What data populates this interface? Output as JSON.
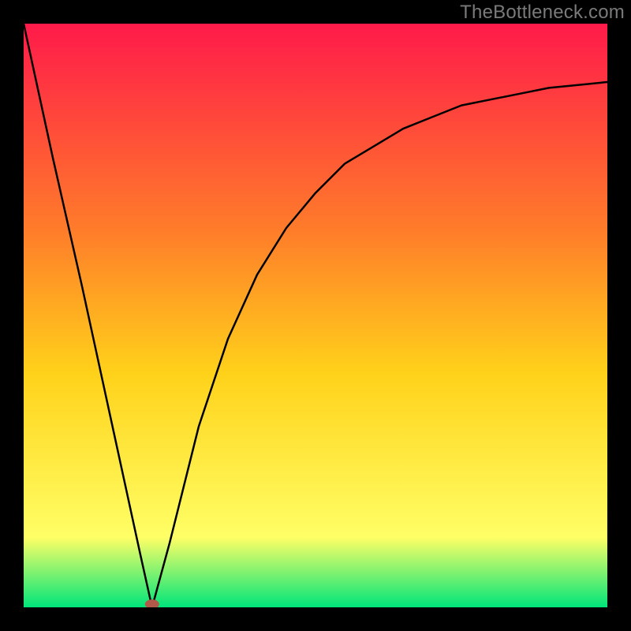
{
  "watermark": "TheBottleneck.com",
  "colors": {
    "bg": "#000000",
    "curve": "#000000",
    "marker": "#b15a4a",
    "gradient_top": "#ff1a4a",
    "gradient_mid_upper": "#ff7b2a",
    "gradient_mid": "#ffd21a",
    "gradient_mid_lower": "#ffff66",
    "gradient_bottom": "#00e57a"
  },
  "chart_data": {
    "type": "line",
    "title": "",
    "xlabel": "",
    "ylabel": "",
    "xlim": [
      0,
      100
    ],
    "ylim": [
      0,
      100
    ],
    "grid": false,
    "legend": false,
    "marker": {
      "x": 22,
      "y": 0
    },
    "series": [
      {
        "name": "curve",
        "x": [
          0,
          5,
          10,
          15,
          20,
          22,
          25,
          30,
          35,
          40,
          45,
          50,
          55,
          60,
          65,
          70,
          75,
          80,
          85,
          90,
          95,
          100
        ],
        "y": [
          100,
          77,
          55,
          32,
          9,
          0,
          11,
          31,
          46,
          57,
          65,
          71,
          76,
          79,
          82,
          84,
          86,
          87,
          88,
          89,
          89.5,
          90
        ]
      }
    ]
  }
}
